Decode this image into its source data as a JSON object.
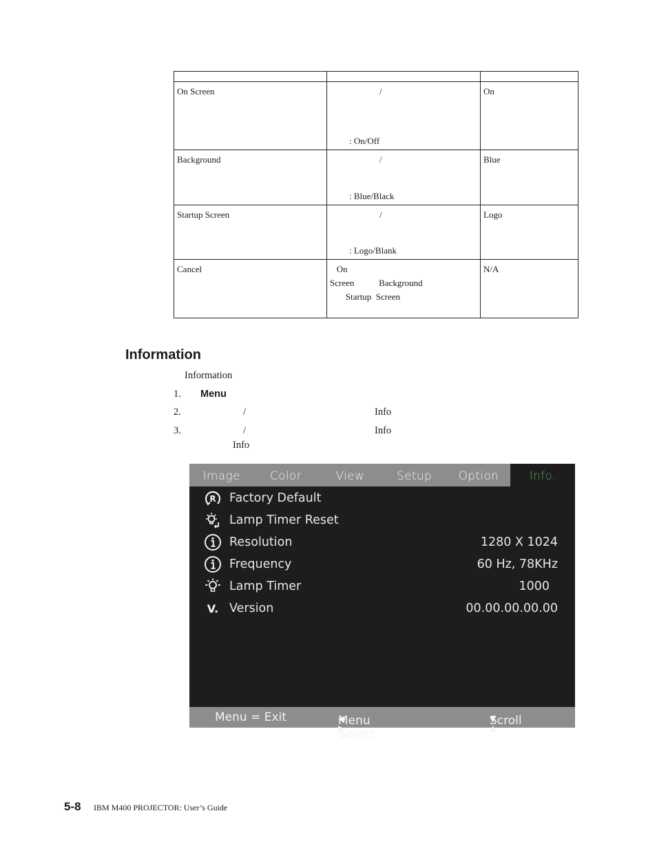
{
  "table": {
    "header": [
      "",
      "",
      ""
    ],
    "rows": [
      {
        "name": "On  Screen",
        "slash": "/",
        "options": ":  On/Off",
        "default": "On"
      },
      {
        "name": "Background",
        "slash": "/",
        "options": ":  Blue/Black",
        "default": "Blue"
      },
      {
        "name": "Startup  Screen",
        "slash": "/",
        "options": ":  Logo/Blank",
        "default": "Logo"
      },
      {
        "name": "Cancel",
        "desc_lines": [
          "   On",
          "Screen           Background",
          "       Startup  Screen"
        ],
        "default": "N/A"
      }
    ]
  },
  "section": {
    "title": "Information",
    "intro": "Information",
    "steps": [
      {
        "num": "1.",
        "keyword": "Menu"
      },
      {
        "num": "2.",
        "slash": "/",
        "target": "Info"
      },
      {
        "num": "3.",
        "slash": "/",
        "target": "Info",
        "continuation": "Info"
      }
    ]
  },
  "osd": {
    "tabs": [
      {
        "label": "Image",
        "active": false
      },
      {
        "label": "Color",
        "active": false
      },
      {
        "label": "View",
        "active": false
      },
      {
        "label": "Setup",
        "active": false
      },
      {
        "label": "Option",
        "active": false
      },
      {
        "label": "Info.",
        "active": true
      }
    ],
    "items": [
      {
        "icon": "factory-reset-icon",
        "label": "Factory Default",
        "value": ""
      },
      {
        "icon": "lamp-reset-icon",
        "label": "Lamp Timer Reset",
        "value": ""
      },
      {
        "icon": "info-icon",
        "label": "Resolution",
        "value": "1280 X 1024"
      },
      {
        "icon": "info-icon",
        "label": "Frequency",
        "value": "60 Hz, 78KHz"
      },
      {
        "icon": "lamp-icon",
        "label": "Lamp Timer",
        "value": "1000"
      },
      {
        "icon": "version-icon",
        "label": "Version",
        "value": "00.00.00.00.00"
      }
    ],
    "footer": {
      "exit": "Menu = Exit",
      "select": "Menu Select",
      "select_arrows": "◀ ▶",
      "scroll": "Scroll",
      "scroll_arrows": "▼ ▲"
    },
    "colors": {
      "background": "#1e1c1c",
      "bar": "#8d8d8d",
      "active_tab_text": "#3fae5a"
    }
  },
  "page_footer": {
    "page_number": "5-8",
    "title": "IBM  M400  PROJECTOR:  User’s  Guide"
  }
}
